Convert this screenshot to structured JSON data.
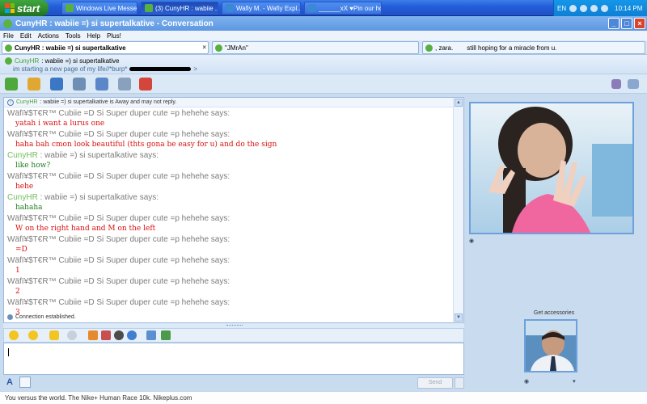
{
  "taskbar": {
    "start_label": "start",
    "tasks": [
      {
        "label": "Windows Live Messen...",
        "active": false
      },
      {
        "label": "(3) CunyHR : wabiie ...",
        "active": true
      },
      {
        "label": "Wafiy M. - Wafiy Expl...",
        "active": false
      },
      {
        "label": "______xX ♥Pin our hop...",
        "active": false
      }
    ],
    "lang": "EN",
    "clock": "10:14 PM"
  },
  "window": {
    "title": "CunyHR : wabiie =) si supertalkative - Conversation"
  },
  "menu": [
    "File",
    "Edit",
    "Actions",
    "Tools",
    "Help",
    "Plus!"
  ],
  "conversation_tabs": [
    {
      "label": "CunyHR : wabiie =) si supertalkative",
      "selected": true
    },
    {
      "label": "\"JMrAn\"",
      "selected": false
    },
    {
      "label": ", zara.",
      "extra": "still hoping for a miracle from u.",
      "selected": false
    }
  ],
  "contact": {
    "name": "CunyHR",
    "name_rest": ": wabiie =) si supertalkative",
    "personal_message": "im starting a new page of my life//*burp*",
    "pm_trail": ">"
  },
  "info": {
    "name": "CunyHR",
    "text": ": wabiie =) si supertalkative is Away and may not reply."
  },
  "messages": [
    {
      "sender": "Wäfï¥$T€R™ Cubiie =D Si Super duper cute =p hehehe says:",
      "text": "yatah i want a lurus one",
      "me": true
    },
    {
      "sender": "Wäfï¥$T€R™ Cubiie =D Si Super duper cute =p hehehe says:",
      "text": "haha bah cmon look beautiful (thts gona be easy for u) and do the sign",
      "me": true
    },
    {
      "sender_name": "CunyHR",
      "sender": ": wabiie =) si supertalkative says:",
      "text": "like how?",
      "me": false
    },
    {
      "sender": "Wäfï¥$T€R™ Cubiie =D Si Super duper cute =p hehehe says:",
      "text": "hehe",
      "me": true
    },
    {
      "sender_name": "CunyHR",
      "sender": ": wabiie =) si supertalkative says:",
      "text": "hahaha",
      "me": false
    },
    {
      "sender": "Wäfï¥$T€R™ Cubiie =D Si Super duper cute =p hehehe says:",
      "text": "W on the right hand and M on the left",
      "me": true
    },
    {
      "sender": "Wäfï¥$T€R™ Cubiie =D Si Super duper cute =p hehehe says:",
      "text": "=D",
      "me": true
    },
    {
      "sender": "Wäfï¥$T€R™ Cubiie =D Si Super duper cute =p hehehe says:",
      "text": "1",
      "me": true
    },
    {
      "sender": "Wäfï¥$T€R™ Cubiie =D Si Super duper cute =p hehehe says:",
      "text": "2",
      "me": true
    },
    {
      "sender": "Wäfï¥$T€R™ Cubiie =D Si Super duper cute =p hehehe says:",
      "text": "3",
      "me": true
    }
  ],
  "status_text": "Connection established.",
  "input": {
    "value": ""
  },
  "send_label": "Send",
  "accessories_label": "Get accessories",
  "ad_text": "You versus the world. The Nike+ Human Race 10k. Nikeplus.com",
  "colors": {
    "my_text": "#d81010",
    "contact_text": "#1e7d1e",
    "contact_name": "#6fbf5b"
  }
}
